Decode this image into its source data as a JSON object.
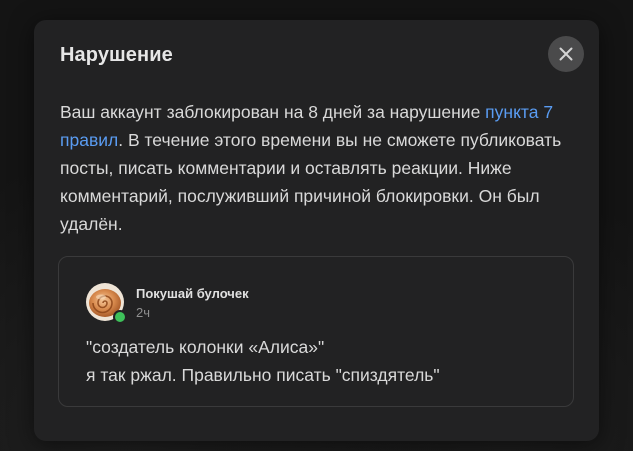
{
  "dialog": {
    "title": "Нарушение",
    "body_before_link": "Ваш аккаунт заблокирован на 8 дней за нарушение ",
    "rules_link_text": "пункта 7 правил",
    "body_after_link": ". В течение этого времени вы не сможете публиковать посты, писать комментарии и оставлять реакции. Ниже комментарий, послуживший причиной блокировки. Он был удалён.",
    "close_icon": "close-icon"
  },
  "comment": {
    "author": "Покушай булочек",
    "time": "2ч",
    "lines": [
      "\"создатель колонки «Алиса»\"",
      "я так ржал. Правильно писать \"спиздятель\""
    ],
    "avatar_icon": "cinnamon-roll-avatar",
    "online_status_icon": "online-dot"
  },
  "colors": {
    "background": "#141414",
    "modal": "#222223",
    "link": "#5a9cf2",
    "online": "#3ec15a",
    "close_button": "#4a4a4b"
  }
}
